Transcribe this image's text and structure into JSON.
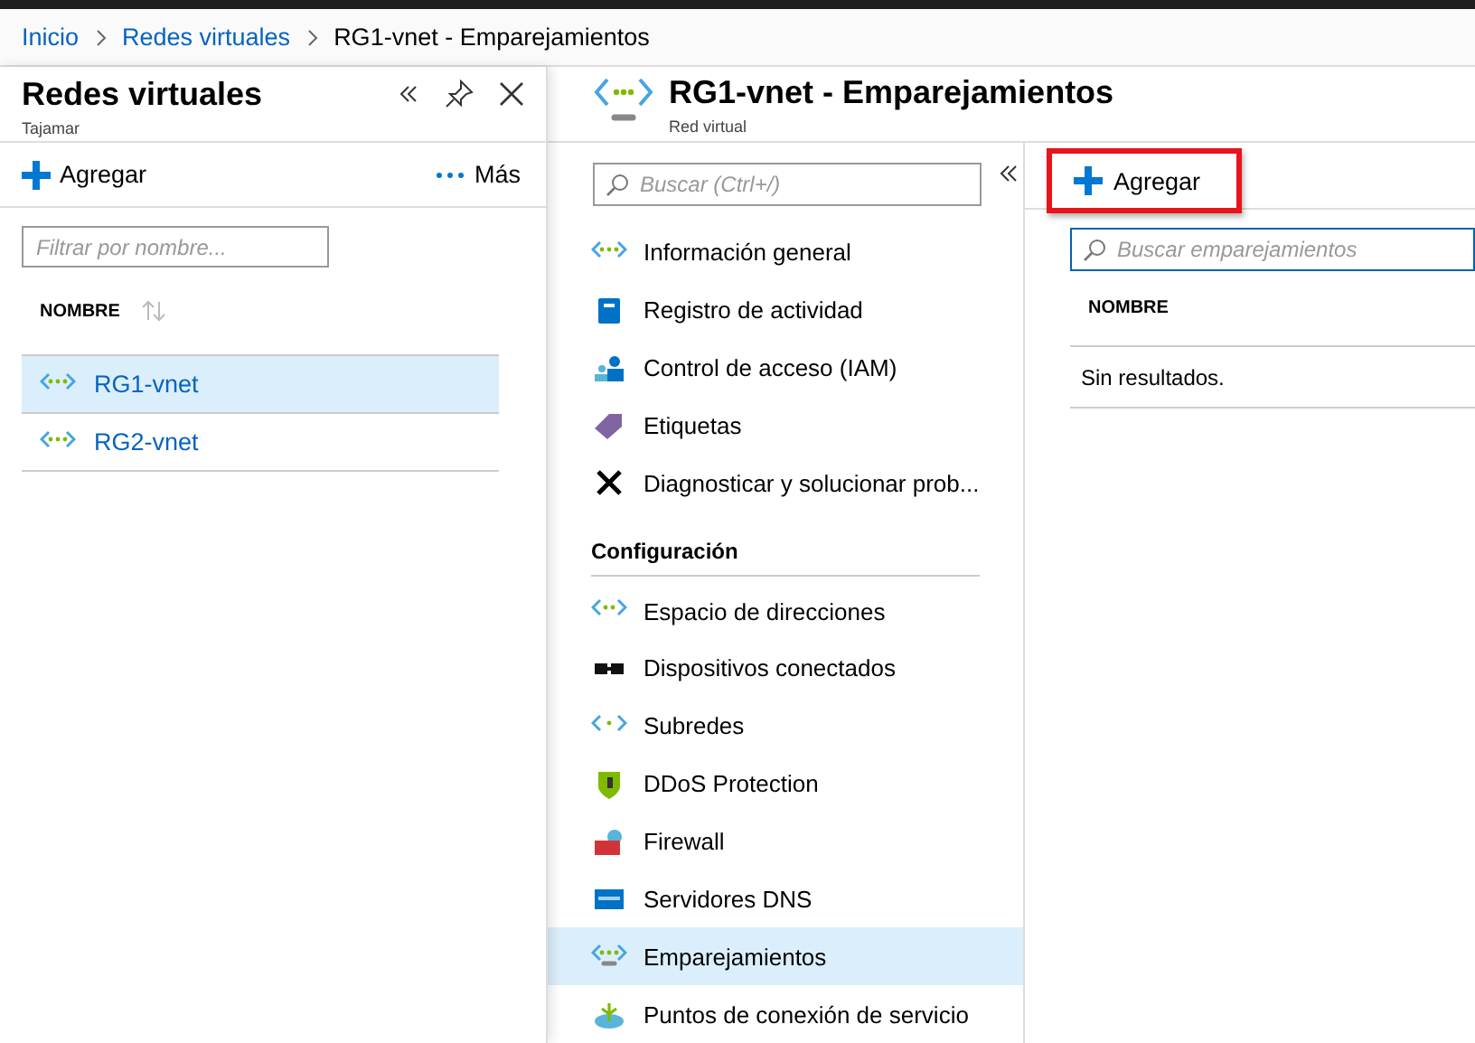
{
  "breadcrumb": [
    {
      "label": "Inicio",
      "link": true
    },
    {
      "label": "Redes virtuales",
      "link": true
    },
    {
      "label": "RG1-vnet - Emparejamientos",
      "link": false
    }
  ],
  "left_blade": {
    "title": "Redes virtuales",
    "subtitle": "Tajamar",
    "toolbar": {
      "add": "Agregar",
      "more": "Más"
    },
    "filter": {
      "placeholder": "Filtrar por nombre..."
    },
    "column": "NOMBRE",
    "rows": [
      {
        "name": "RG1-vnet",
        "selected": true
      },
      {
        "name": "RG2-vnet",
        "selected": false
      }
    ]
  },
  "blade": {
    "title": "RG1-vnet - Emparejamientos",
    "subtitle": "Red virtual",
    "search": {
      "placeholder": "Buscar (Ctrl+/)"
    },
    "menu": [
      {
        "kind": "item",
        "label": "Información general",
        "selected": false
      },
      {
        "kind": "item",
        "label": "Registro de actividad",
        "selected": false
      },
      {
        "kind": "item",
        "label": "Control de acceso (IAM)",
        "selected": false
      },
      {
        "kind": "item",
        "label": "Etiquetas",
        "selected": false
      },
      {
        "kind": "item",
        "label": "Diagnosticar y solucionar prob...",
        "selected": false
      },
      {
        "kind": "section",
        "label": "Configuración"
      },
      {
        "kind": "item",
        "label": "Espacio de direcciones",
        "selected": false
      },
      {
        "kind": "item",
        "label": "Dispositivos conectados",
        "selected": false
      },
      {
        "kind": "item",
        "label": "Subredes",
        "selected": false
      },
      {
        "kind": "item",
        "label": "DDoS Protection",
        "selected": false
      },
      {
        "kind": "item",
        "label": "Firewall",
        "selected": false
      },
      {
        "kind": "item",
        "label": "Servidores DNS",
        "selected": false
      },
      {
        "kind": "item",
        "label": "Emparejamientos",
        "selected": true
      },
      {
        "kind": "item",
        "label": "Puntos de conexión de servicio",
        "selected": false
      }
    ]
  },
  "content": {
    "add": {
      "label": "Agregar",
      "highlighted": true
    },
    "search": {
      "placeholder": "Buscar emparejamientos"
    },
    "column": "NOMBRE",
    "empty": "Sin resultados."
  }
}
